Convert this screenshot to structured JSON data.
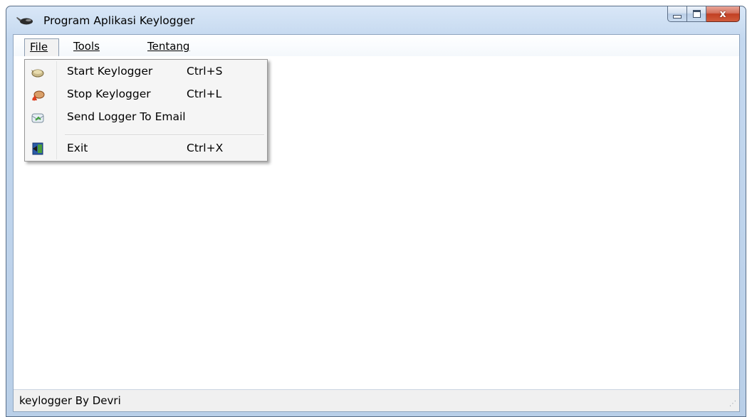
{
  "window": {
    "title": "Program Aplikasi Keylogger",
    "close_glyph": "x"
  },
  "menubar": {
    "file": "File",
    "tools": "Tools",
    "tentang": "Tentang"
  },
  "file_menu": {
    "items": [
      {
        "label": "Start Keylogger",
        "shortcut": "Ctrl+S",
        "icon": "start-icon"
      },
      {
        "label": "Stop Keylogger",
        "shortcut": "Ctrl+L",
        "icon": "stop-icon"
      },
      {
        "label": "Send Logger To Email",
        "shortcut": "",
        "icon": "email-icon"
      },
      {
        "label": "Exit",
        "shortcut": "Ctrl+X",
        "icon": "exit-icon"
      }
    ]
  },
  "statusbar": {
    "text": "keylogger By Devri"
  },
  "colors": {
    "frame": "#b9cfe8",
    "close_button": "#c13f23",
    "menu_background": "#f5f5f5"
  }
}
